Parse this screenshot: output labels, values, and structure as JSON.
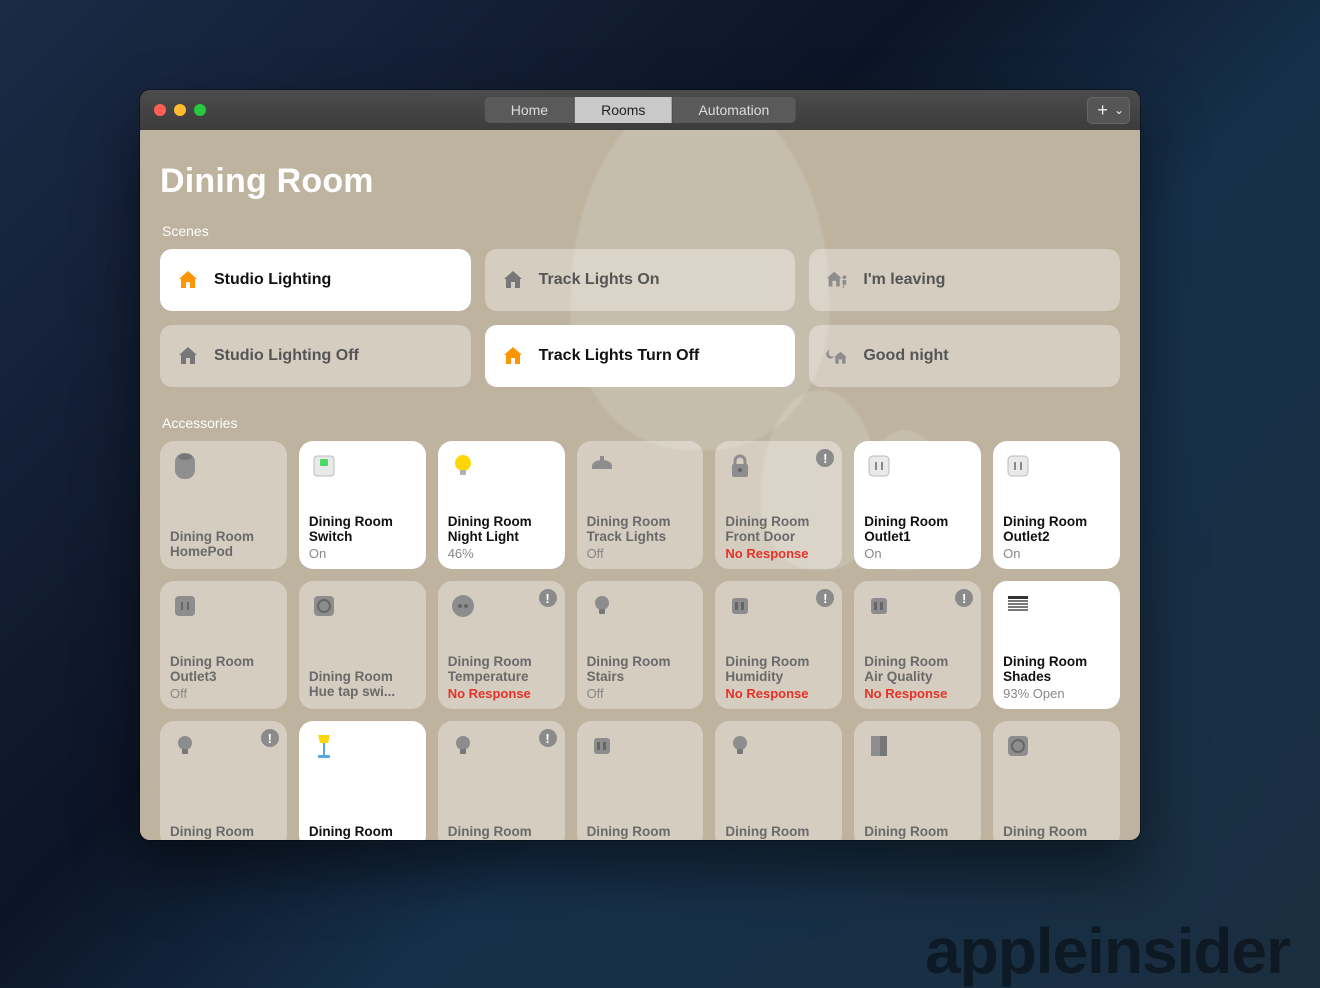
{
  "tabs": [
    {
      "label": "Home",
      "active": false
    },
    {
      "label": "Rooms",
      "active": true
    },
    {
      "label": "Automation",
      "active": false
    }
  ],
  "roomTitle": "Dining Room",
  "sectionScenes": "Scenes",
  "sectionAccessories": "Accessories",
  "scenes": [
    {
      "label": "Studio Lighting",
      "icon": "house",
      "active": true
    },
    {
      "label": "Track Lights On",
      "icon": "house",
      "active": false
    },
    {
      "label": "I'm leaving",
      "icon": "house-leave",
      "active": false
    },
    {
      "label": "Studio Lighting Off",
      "icon": "house",
      "active": false
    },
    {
      "label": "Track Lights Turn Off",
      "icon": "house",
      "active": true
    },
    {
      "label": "Good night",
      "icon": "moon-house",
      "active": false
    }
  ],
  "accessories": [
    {
      "name": "Dining Room\nHomePod",
      "status": "",
      "icon": "homepod",
      "active": false,
      "warn": false
    },
    {
      "name": "Dining Room\nSwitch",
      "status": "On",
      "icon": "switch",
      "active": true,
      "warn": false
    },
    {
      "name": "Dining Room\nNight Light",
      "status": "46%",
      "icon": "bulb-on",
      "active": true,
      "warn": false
    },
    {
      "name": "Dining Room\nTrack Lights",
      "status": "Off",
      "icon": "ceiling-light",
      "active": false,
      "warn": false
    },
    {
      "name": "Dining Room\nFront Door",
      "status": "No Response",
      "icon": "lock",
      "active": false,
      "warn": true,
      "err": true
    },
    {
      "name": "Dining Room\nOutlet1",
      "status": "On",
      "icon": "outlet",
      "active": true,
      "warn": false
    },
    {
      "name": "Dining Room\nOutlet2",
      "status": "On",
      "icon": "outlet",
      "active": true,
      "warn": false
    },
    {
      "name": "Dining Room\nOutlet3",
      "status": "Off",
      "icon": "outlet",
      "active": false,
      "warn": false
    },
    {
      "name": "Dining Room\nHue tap swi...",
      "status": "",
      "icon": "circle-sq",
      "active": false,
      "warn": false
    },
    {
      "name": "Dining Room\nTemperature",
      "status": "No Response",
      "icon": "thermostat",
      "active": false,
      "warn": true,
      "err": true
    },
    {
      "name": "Dining Room\nStairs",
      "status": "Off",
      "icon": "bulb",
      "active": false,
      "warn": false
    },
    {
      "name": "Dining Room\nHumidity",
      "status": "No Response",
      "icon": "sensor",
      "active": false,
      "warn": true,
      "err": true
    },
    {
      "name": "Dining Room\nAir Quality",
      "status": "No Response",
      "icon": "sensor",
      "active": false,
      "warn": true,
      "err": true
    },
    {
      "name": "Dining Room\nShades",
      "status": "93% Open",
      "icon": "shades",
      "active": true,
      "warn": false
    },
    {
      "name": "Dining Room",
      "status": "",
      "icon": "bulb",
      "active": false,
      "warn": true
    },
    {
      "name": "Dining Room",
      "status": "",
      "icon": "lamp",
      "active": true,
      "warn": false
    },
    {
      "name": "Dining Room",
      "status": "",
      "icon": "bulb",
      "active": false,
      "warn": true
    },
    {
      "name": "Dining Room",
      "status": "",
      "icon": "sensor",
      "active": false,
      "warn": false
    },
    {
      "name": "Dining Room",
      "status": "",
      "icon": "bulb",
      "active": false,
      "warn": false
    },
    {
      "name": "Dining Room",
      "status": "",
      "icon": "door",
      "active": false,
      "warn": false
    },
    {
      "name": "Dining Room",
      "status": "",
      "icon": "circle-sq",
      "active": false,
      "warn": false
    }
  ],
  "watermark": "appleinsider"
}
